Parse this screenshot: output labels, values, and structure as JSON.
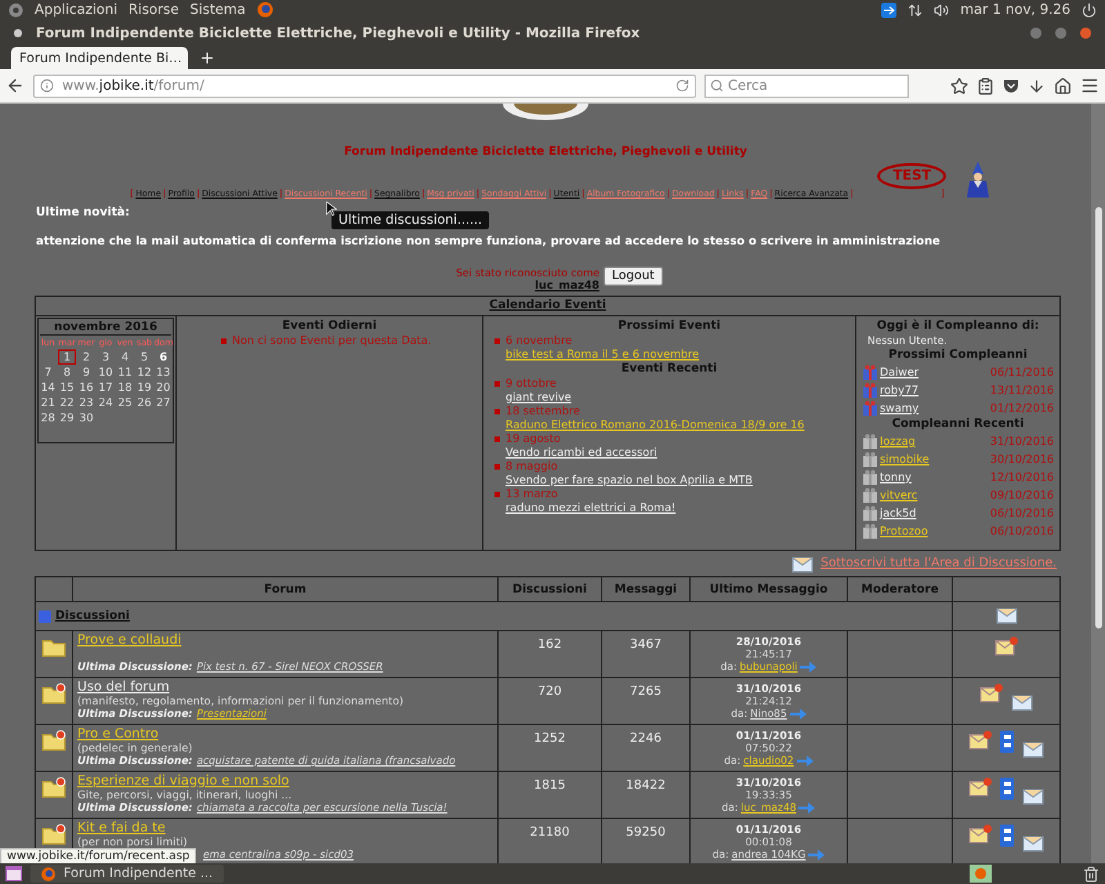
{
  "system_bar": {
    "menus": [
      "Applicazioni",
      "Risorse",
      "Sistema"
    ],
    "clock": "mar 1 nov, 9.26"
  },
  "window": {
    "title": "Forum Indipendente Biciclette Elettriche, Pieghevoli e Utility - Mozilla Firefox"
  },
  "tabs": [
    {
      "label": "Forum Indipendente Bi…",
      "selected": true
    }
  ],
  "address_bar": {
    "prefix": "www.",
    "domain": "jobike.it",
    "path": "/forum/"
  },
  "search": {
    "placeholder": "Cerca"
  },
  "page": {
    "site_title": "Forum Indipendente Biciclette Elettriche, Pieghevoli e Utility",
    "nav": {
      "open": "[",
      "close": "]",
      "separator": "|",
      "links": [
        {
          "label": "Home",
          "visited": true
        },
        {
          "label": "Profilo",
          "visited": true
        },
        {
          "label": "Discussioni Attive",
          "visited": true
        },
        {
          "label": "Discussioni Recenti",
          "visited": false
        },
        {
          "label": "Segnalibro",
          "visited": true
        },
        {
          "label": "Msg privati",
          "visited": false
        },
        {
          "label": "Sondaggi Attivi",
          "visited": false
        },
        {
          "label": "Utenti",
          "visited": true
        },
        {
          "label": "Album Fotografico",
          "visited": false
        },
        {
          "label": "Download",
          "visited": false
        },
        {
          "label": "Links",
          "visited": false
        },
        {
          "label": "FAQ",
          "visited": false
        },
        {
          "label": "Ricerca Avanzata",
          "visited": true
        }
      ]
    },
    "test_badge": "TEST",
    "news_label": "Ultime novità:",
    "tooltip": "Ultime discussioni......",
    "notice": "attenzione che la mail automatica di conferma iscrizione non sempre funziona, provare ad accedere lo stesso o scrivere in amministrazione",
    "login": {
      "text": "Sei stato riconosciuto come",
      "user": "luc_maz48",
      "button": "Logout"
    },
    "calendar": {
      "title": "Calendario Eventi",
      "month": "novembre 2016",
      "weekdays": [
        "lun",
        "mar",
        "mer",
        "gio",
        "ven",
        "sab",
        "dom"
      ],
      "weeks": [
        [
          {
            "day": "1",
            "selected": true,
            "event": false
          },
          {
            "day": "2",
            "selected": false,
            "event": false
          },
          {
            "day": "3",
            "selected": false,
            "event": false
          },
          {
            "day": "4",
            "selected": false,
            "event": false
          },
          {
            "day": "5",
            "selected": false,
            "event": false
          },
          {
            "day": "6",
            "selected": false,
            "event": true
          }
        ],
        [
          {
            "day": "7",
            "selected": false,
            "event": false
          },
          {
            "day": "8",
            "selected": false,
            "event": false
          },
          {
            "day": "9",
            "selected": false,
            "event": false
          },
          {
            "day": "10",
            "selected": false,
            "event": false
          },
          {
            "day": "11",
            "selected": false,
            "event": false
          },
          {
            "day": "12",
            "selected": false,
            "event": false
          },
          {
            "day": "13",
            "selected": false,
            "event": false
          }
        ],
        [
          {
            "day": "14",
            "selected": false,
            "event": false
          },
          {
            "day": "15",
            "selected": false,
            "event": false
          },
          {
            "day": "16",
            "selected": false,
            "event": false
          },
          {
            "day": "17",
            "selected": false,
            "event": false
          },
          {
            "day": "18",
            "selected": false,
            "event": false
          },
          {
            "day": "19",
            "selected": false,
            "event": false
          },
          {
            "day": "20",
            "selected": false,
            "event": false
          }
        ],
        [
          {
            "day": "21",
            "selected": false,
            "event": false
          },
          {
            "day": "22",
            "selected": false,
            "event": false
          },
          {
            "day": "23",
            "selected": false,
            "event": false
          },
          {
            "day": "24",
            "selected": false,
            "event": false
          },
          {
            "day": "25",
            "selected": false,
            "event": false
          },
          {
            "day": "26",
            "selected": false,
            "event": false
          },
          {
            "day": "27",
            "selected": false,
            "event": false
          }
        ],
        [
          {
            "day": "28",
            "selected": false,
            "event": false
          },
          {
            "day": "29",
            "selected": false,
            "event": false
          },
          {
            "day": "30",
            "selected": false,
            "event": false
          }
        ]
      ]
    },
    "today_events": {
      "title": "Eventi Odierni",
      "items": [
        "Non ci sono Eventi per questa Data."
      ]
    },
    "upcoming_events": {
      "title": "Prossimi Eventi",
      "items": [
        {
          "date": "6 novembre",
          "link": "bike test a Roma il 5 e 6 novembre",
          "visited": false
        }
      ]
    },
    "recent_events": {
      "title": "Eventi Recenti",
      "items": [
        {
          "date": "9 ottobre",
          "link": "giant revive",
          "visited": true
        },
        {
          "date": "18 settembre",
          "link": "Raduno Elettrico Romano 2016-Domenica 18/9 ore 16",
          "visited": false
        },
        {
          "date": "19 agosto",
          "link": "Vendo ricambi ed accessori",
          "visited": true
        },
        {
          "date": "8 maggio",
          "link": "Svendo per fare spazio nel box Aprilia e MTB",
          "visited": true
        },
        {
          "date": "13 marzo",
          "link": "raduno mezzi elettrici a Roma!",
          "visited": true
        }
      ]
    },
    "birthdays_today": {
      "title": "Oggi è il Compleanno di:",
      "text": "Nessun Utente."
    },
    "upcoming_birthdays": {
      "title": "Prossimi Compleanni",
      "kind": "upcoming",
      "items": [
        {
          "user": "Daiwer",
          "date": "06/11/2016",
          "visited": true
        },
        {
          "user": "roby77",
          "date": "13/11/2016",
          "visited": true
        },
        {
          "user": "swamy",
          "date": "01/12/2016",
          "visited": true
        }
      ]
    },
    "recent_birthdays": {
      "title": "Compleanni Recenti",
      "kind": "past",
      "items": [
        {
          "user": "Iozzag",
          "date": "31/10/2016",
          "visited": false
        },
        {
          "user": "simobike",
          "date": "30/10/2016",
          "visited": false
        },
        {
          "user": "tonny",
          "date": "12/10/2016",
          "visited": true
        },
        {
          "user": "vitverc",
          "date": "09/10/2016",
          "visited": false
        },
        {
          "user": "jack5d",
          "date": "06/10/2016",
          "visited": true
        },
        {
          "user": "Protozoo",
          "date": "06/10/2016",
          "visited": false
        }
      ]
    },
    "subscribe_link": "Sottoscrivi tutta l'Area di Discussione.",
    "forum_table": {
      "columns": [
        "Forum",
        "Discussioni",
        "Messaggi",
        "Ultimo Messaggio",
        "Moderatore"
      ],
      "category": "Discussioni",
      "rows": [
        {
          "name": "Prove e collaudi",
          "visited": false,
          "new": false,
          "last_label": "Ultima Discussione:",
          "last_topic": "Pix test n. 67 - Sirel NEOX CROSSER",
          "topic_visited": true,
          "topics": "162",
          "posts": "3467",
          "date": "28/10/2016",
          "time": "21:45:17",
          "by_label": "da:",
          "user": "bubunapoli",
          "user_visited": false,
          "actions": [
            {
              "kind": "new-post"
            }
          ]
        },
        {
          "name": "Uso del forum",
          "visited": true,
          "new": true,
          "description": "(manifesto, regolamento, informazioni per il funzionamento)",
          "last_label": "Ultima Discussione:",
          "last_topic": "Presentazioni",
          "topic_visited": false,
          "topics": "720",
          "posts": "7265",
          "date": "31/10/2016",
          "time": "21:24:12",
          "by_label": "da:",
          "user": "Nino85",
          "user_visited": true,
          "actions": [
            {
              "kind": "new-post"
            },
            {
              "kind": "subscribe"
            }
          ]
        },
        {
          "name": "Pro e Contro",
          "visited": false,
          "new": true,
          "description": "(pedelec in generale)",
          "last_label": "Ultima Discussione:",
          "last_topic": "acquistare patente di guida italiana (francsalvado",
          "topic_visited": true,
          "topics": "1252",
          "posts": "2246",
          "date": "01/11/2016",
          "time": "07:50:22",
          "by_label": "da:",
          "user": "claudio02",
          "user_visited": false,
          "actions": [
            {
              "kind": "new-post"
            },
            {
              "kind": "info"
            },
            {
              "kind": "subscribe"
            }
          ]
        },
        {
          "name": "Esperienze di viaggio e non solo",
          "visited": false,
          "new": true,
          "description": "Gite, percorsi, viaggi, itinerari, luoghi ...",
          "last_label": "Ultima Discussione:",
          "last_topic": "chiamata a raccolta per escursione nella Tuscia!",
          "topic_visited": true,
          "topics": "1815",
          "posts": "18422",
          "date": "31/10/2016",
          "time": "19:33:35",
          "by_label": "da:",
          "user": "luc_maz48",
          "user_visited": false,
          "actions": [
            {
              "kind": "new-post"
            },
            {
              "kind": "info"
            },
            {
              "kind": "subscribe"
            }
          ]
        },
        {
          "name": "Kit e fai da te",
          "visited": false,
          "new": true,
          "description": "(per non porsi limiti)",
          "last_topic": "ema centralina s09p - sicd03",
          "topic_visited": true,
          "topics": "21180",
          "posts": "59250",
          "date": "01/11/2016",
          "time": "00:01:08",
          "by_label": "da:",
          "user": "andrea 104KG",
          "user_visited": true,
          "actions": [
            {
              "kind": "new-post"
            },
            {
              "kind": "info"
            },
            {
              "kind": "subscribe"
            }
          ]
        }
      ]
    }
  },
  "status_url": "www.jobike.it/forum/recent.asp",
  "taskbar": {
    "items": [
      {
        "label": "Forum Indipendente ...",
        "selected": false
      }
    ]
  }
}
